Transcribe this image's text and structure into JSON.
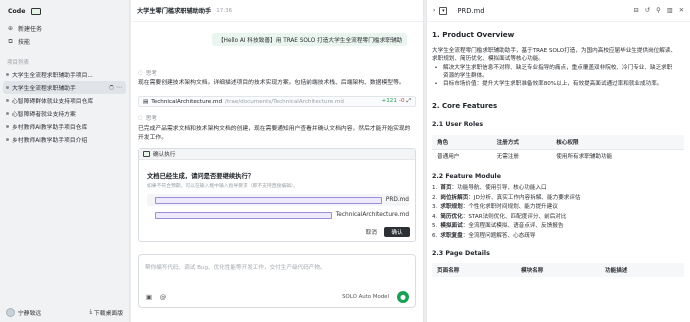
{
  "sidebar": {
    "mode_label": "Code",
    "new_task": "新建任务",
    "skills": "技能",
    "section_label": "项目列表",
    "projects": [
      {
        "label": "大学生全流程求职辅助手项目..."
      },
      {
        "label": "大学生全流程求职辅助手"
      },
      {
        "label": "心智障碍群体就业支持项目仓库"
      },
      {
        "label": "心智障碍者就业支持方案"
      },
      {
        "label": "乡村教师AI教学助手项目仓库"
      },
      {
        "label": "乡村教师AI教学助手项目介绍"
      }
    ],
    "user_name": "宁静致远",
    "download_label": "下载桌面版"
  },
  "chat": {
    "title": "大学生零门槛求职辅助助手",
    "time": "17:36",
    "user_message": "【Hello AI 科技致善】用 TRAE SOLO 打造大学生全流程零门槛求职辅助",
    "thinking_label": "思考",
    "para1": "现在需要创建技术架构文档。详细描述项目的技术实现方案。包括前端技术栈、后端架构、数据模型等。",
    "file_chip": {
      "name": "TechnicalArchitecture.md",
      "path": "/trae/documents/TechnicalArchitecture.md",
      "added": "+121",
      "removed": "-0"
    },
    "thinking_label2": "思考",
    "para2": "已完成产品需求文档和技术架构文档的创建，现在需要通知用户查看并确认文档内容，然后才能开始实现的开发工作。",
    "confirm": {
      "header": "确认执行",
      "question": "文档已经生成，请问是否要继续执行？",
      "hint": "如果不符合预期，可以在输入框中输入指导要求（即不支持直接编辑）。",
      "options": [
        "PRD.md",
        "TechnicalArchitecture.md"
      ],
      "cancel": "取消",
      "ok": "确认"
    },
    "input_placeholder": "帮你编写代码、调试 Bug、优化性能等开发工作，交付生产级代码产物。",
    "model_label": "SOLO Auto Model"
  },
  "doc": {
    "tab_name": "PRD.md",
    "h1": "1. Product Overview",
    "p1_line1": "大学生全流程零门槛求职辅助助手，基于TRAE SOLO打造，为国内高校应届毕业生提供岗位解读、",
    "p1_line2": "求职规划、简历优化、模拟面试等核心功能。",
    "bullet1_line1": "解决大学生求职信息不对称、缺乏专业指导的痛点，重点覆盖双非院校、冷门专业、缺乏求职",
    "bullet1_line2": "资源的学生群体。",
    "bullet2": "目标市场价值：提升大学生求职准备效率80%以上，有效提高面试通过率和就业成功率。",
    "h2": "2. Core Features",
    "h3_roles": "2.1 User Roles",
    "roles_table": {
      "headers": [
        "角色",
        "注册方式",
        "核心权限"
      ],
      "rows": [
        [
          "普通用户",
          "无需注册",
          "使用所有求职辅助功能"
        ]
      ]
    },
    "h3_modules": "2.2 Feature Module",
    "modules": [
      {
        "n": "1.",
        "k": "首页",
        "v": "：功能导航、使用引导、核心功能入口"
      },
      {
        "n": "2.",
        "k": "岗位拆解页",
        "v": "：JD分析、真实工作内容拆解、能力要求评估"
      },
      {
        "n": "3.",
        "k": "求职规划",
        "v": "：个性化求职时间规划、能力提升建议"
      },
      {
        "n": "4.",
        "k": "简历优化",
        "v": "：STAR法则优化、匹配度评分、前后对比"
      },
      {
        "n": "5.",
        "k": "模拟面试",
        "v": "：全流程面试模拟、语音点评、反馈报告"
      },
      {
        "n": "6.",
        "k": "求职复盘",
        "v": "：全流程问题解答、心态疏导"
      }
    ],
    "h3_pages": "2.3 Page Details",
    "pages_table_headers": [
      "页面名称",
      "模块名称",
      "功能描述"
    ]
  }
}
